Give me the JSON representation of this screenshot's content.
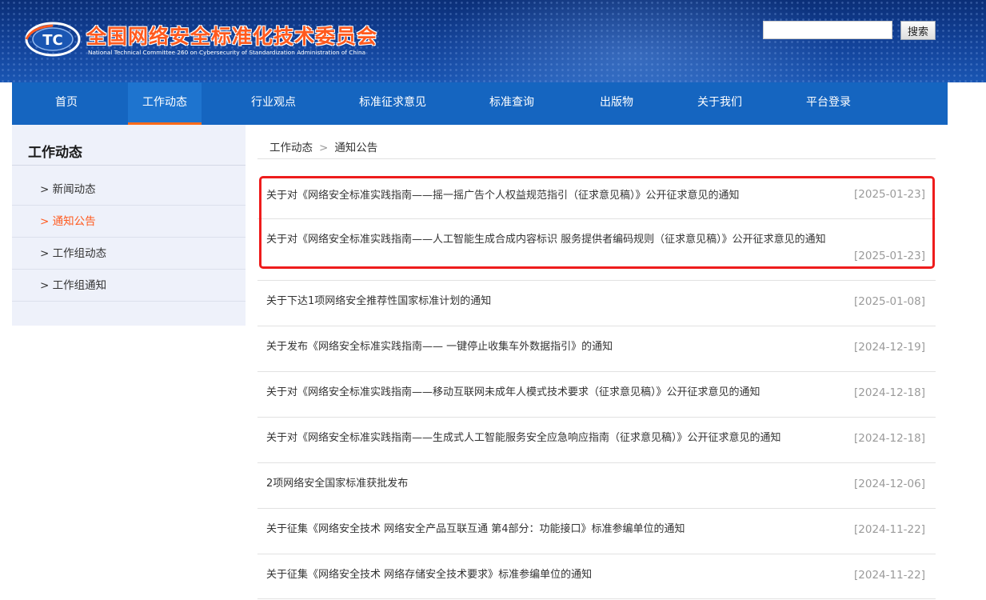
{
  "header": {
    "title": "全国网络安全标准化技术委员会",
    "subtitle": "National Technical Committee 260 on Cybersecurity of Standardization Administration of China",
    "logo_text": "TC",
    "search": {
      "placeholder": "",
      "value": "",
      "button_label": "搜索"
    }
  },
  "nav": {
    "items": [
      {
        "label": "首页"
      },
      {
        "label": "工作动态"
      },
      {
        "label": "行业观点"
      },
      {
        "label": "标准征求意见"
      },
      {
        "label": "标准查询"
      },
      {
        "label": "出版物"
      },
      {
        "label": "关于我们"
      },
      {
        "label": "平台登录"
      }
    ],
    "active": "工作动态"
  },
  "sidebar": {
    "title": "工作动态",
    "items": [
      {
        "label": "> 新闻动态"
      },
      {
        "label": "> 通知公告"
      },
      {
        "label": "> 工作组动态"
      },
      {
        "label": "> 工作组通知"
      }
    ],
    "active": "> 通知公告"
  },
  "breadcrumb": {
    "items": [
      "工作动态",
      "通知公告"
    ],
    "separator": ">"
  },
  "notices": [
    {
      "title": "关于对《网络安全标准实践指南——摇一摇广告个人权益规范指引（征求意见稿）》公开征求意见的通知",
      "date": "[2025-01-23]"
    },
    {
      "title": "关于对《网络安全标准实践指南——人工智能生成合成内容标识 服务提供者编码规则（征求意见稿）》公开征求意见的通知",
      "date": "[2025-01-23]"
    },
    {
      "title": "关于下达1项网络安全推荐性国家标准计划的通知",
      "date": "[2025-01-08]"
    },
    {
      "title": "关于发布《网络安全标准实践指南—— 一键停止收集车外数据指引》的通知",
      "date": "[2024-12-19]"
    },
    {
      "title": "关于对《网络安全标准实践指南——移动互联网未成年人模式技术要求（征求意见稿）》公开征求意见的通知",
      "date": "[2024-12-18]"
    },
    {
      "title": "关于对《网络安全标准实践指南——生成式人工智能服务安全应急响应指南（征求意见稿）》公开征求意见的通知",
      "date": "[2024-12-18]"
    },
    {
      "title": "2项网络安全国家标准获批发布",
      "date": "[2024-12-06]"
    },
    {
      "title": "关于征集《网络安全技术 网络安全产品互联互通 第4部分：功能接口》标准参编单位的通知",
      "date": "[2024-11-22]"
    },
    {
      "title": "关于征集《网络安全技术 网络存储安全技术要求》标准参编单位的通知",
      "date": "[2024-11-22]"
    }
  ],
  "colors": {
    "nav_bg": "#1565c0",
    "accent": "#ff5a1f",
    "highlight_border": "#ee1c1c",
    "sidebar_bg": "#eef1fa"
  }
}
